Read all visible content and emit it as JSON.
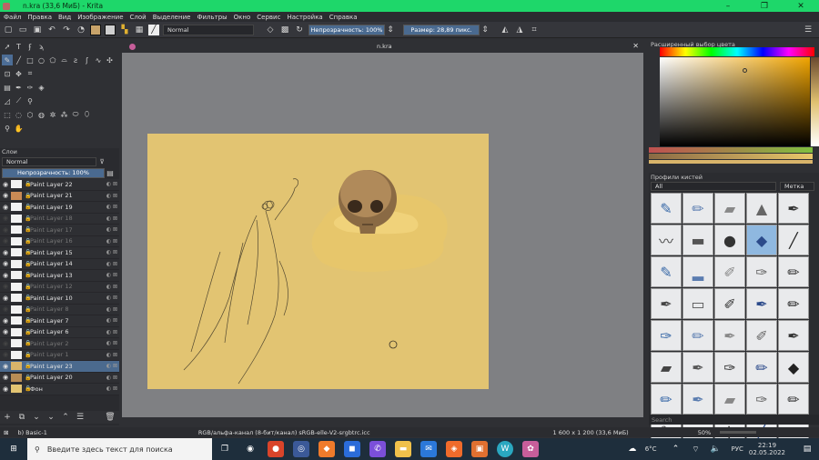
{
  "window": {
    "title": "n.kra (33,6 МиБ) - Krita",
    "controls": [
      "–",
      "❐",
      "✕"
    ]
  },
  "menu": [
    "Файл",
    "Правка",
    "Вид",
    "Изображение",
    "Слой",
    "Выделение",
    "Фильтры",
    "Окно",
    "Сервис",
    "Настройка",
    "Справка"
  ],
  "toolbar": {
    "blend_mode": "Normal",
    "opacity": "Непрозрачность: 100%",
    "size": "Размер: 28,89 пикс.",
    "fg_color": "#c8a36a",
    "bg_color": "#cfcfcf"
  },
  "canvas": {
    "tab": "n.kra",
    "close": "✕",
    "paper_color": "#e2c472"
  },
  "layers_panel": {
    "title": "Слои",
    "blend_mode": "Normal",
    "opacity": "Непрозрачность: 100%",
    "items": [
      {
        "name": "Paint Layer 22",
        "visible": true,
        "thumb": "#f2f2f2"
      },
      {
        "name": "Paint Layer 21",
        "visible": true,
        "thumb": "#c98a55"
      },
      {
        "name": "Paint Layer 19",
        "visible": true,
        "thumb": "#f2f2f2"
      },
      {
        "name": "Paint Layer 18",
        "visible": false,
        "thumb": "#f2f2f2"
      },
      {
        "name": "Paint Layer 17",
        "visible": false,
        "thumb": "#f2f2f2"
      },
      {
        "name": "Paint Layer 16",
        "visible": false,
        "thumb": "#f2f2f2"
      },
      {
        "name": "Paint Layer 15",
        "visible": true,
        "thumb": "#f2f2f2"
      },
      {
        "name": "Paint Layer 14",
        "visible": true,
        "thumb": "#f2f2f2"
      },
      {
        "name": "Paint Layer 13",
        "visible": true,
        "thumb": "#f2f2f2"
      },
      {
        "name": "Paint Layer 12",
        "visible": false,
        "thumb": "#f2f2f2"
      },
      {
        "name": "Paint Layer 10",
        "visible": true,
        "thumb": "#f2f2f2"
      },
      {
        "name": "Paint Layer 8",
        "visible": false,
        "thumb": "#f2f2f2"
      },
      {
        "name": "Paint Layer 7",
        "visible": true,
        "thumb": "#f2f2f2"
      },
      {
        "name": "Paint Layer 6",
        "visible": true,
        "thumb": "#f2f2f2"
      },
      {
        "name": "Paint Layer 2",
        "visible": false,
        "thumb": "#f2f2f2"
      },
      {
        "name": "Paint Layer 1",
        "visible": false,
        "thumb": "#f2f2f2"
      },
      {
        "name": "Paint Layer 23",
        "visible": true,
        "thumb": "#d9b46a",
        "selected": true
      },
      {
        "name": "Paint Layer 20",
        "visible": true,
        "thumb": "#b88d55"
      },
      {
        "name": "Фон",
        "visible": true,
        "thumb": "#e2c472"
      }
    ]
  },
  "color_panel": {
    "title": "Расширенный выбор цвета"
  },
  "brushes_panel": {
    "title": "Профили кистей",
    "filter": "All",
    "tag": "Метка",
    "search_placeholder": "Search"
  },
  "status": {
    "brush": "b) Basic-1",
    "colorspace": "RGB/альфа-канал (8-бит/канал)  sRGB-elle-V2-srgbtrc.icc",
    "dims": "1 600 x 1 200 (33,6 МиБ)",
    "zoom": "50%"
  },
  "taskbar": {
    "search": "Введите здесь текст для поиска",
    "weather": "6°C",
    "lang": "РУС",
    "time": "22:19",
    "date": "02.05.2022"
  }
}
